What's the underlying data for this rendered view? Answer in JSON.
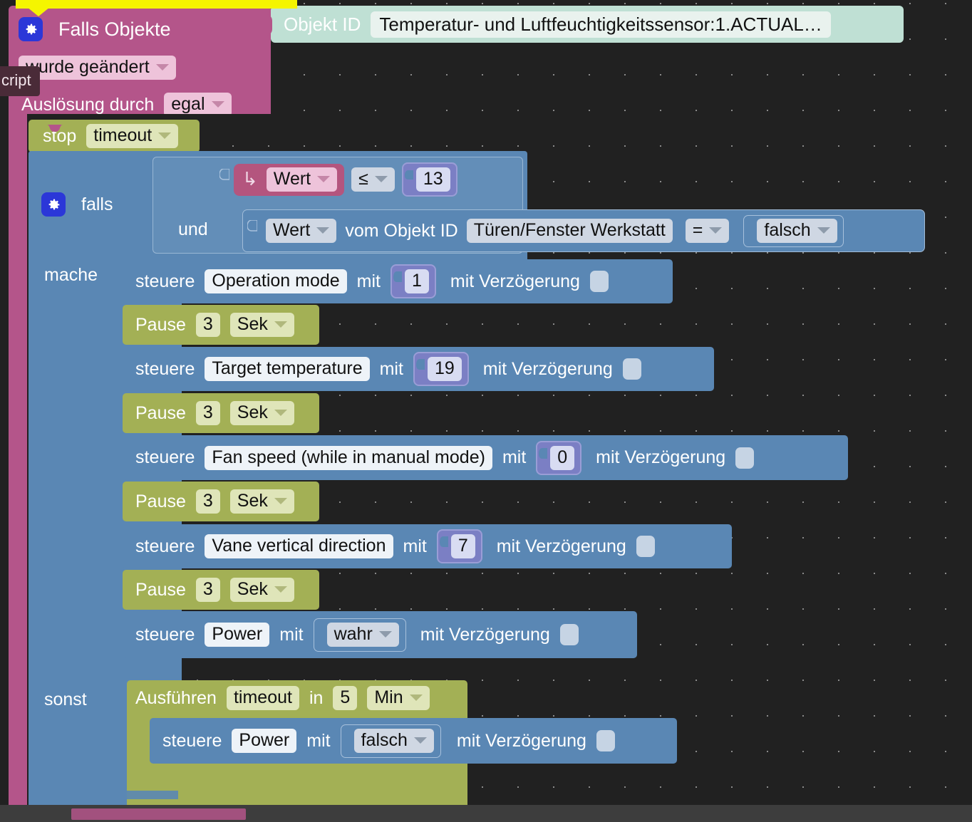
{
  "workspace": {
    "background_color": "#212121",
    "grid_dot_color": "#8a8a8a",
    "grid_spacing_px": 50
  },
  "tooltip": {
    "text": "cript"
  },
  "trigger_block": {
    "gear_icon": "gear-icon",
    "title": "Falls Objekte",
    "condition_dropdown": "wurde geändert",
    "source_label": "Auslösung durch",
    "source_dropdown": "egal",
    "object_id_label": "Objekt ID",
    "object_id_value": "Temperatur- und Luftfeuchtigkeitssensor:1.ACTUAL…",
    "color": "#b4558a",
    "object_id_color": "#bfe0d4"
  },
  "stop_block": {
    "label": "stop",
    "timer_dropdown": "timeout",
    "color": "#a3b055"
  },
  "if_block": {
    "gear_icon": "gear-icon",
    "if_label": "falls",
    "and_label": "und",
    "do_label": "mache",
    "else_label": "sonst",
    "color": "#5a87b4"
  },
  "condition_1": {
    "value_icon": "return-arrow-icon",
    "left_dropdown": "Wert",
    "operator": "≤",
    "right_number": "13",
    "left_color": "#b4557e",
    "number_color": "#7b7fc4"
  },
  "condition_2": {
    "left_dropdown": "Wert",
    "middle_label": "vom Objekt ID",
    "object_id": "Türen/Fenster Werkstatt",
    "operator": "=",
    "right_value": "falsch"
  },
  "do_statements": [
    {
      "type": "control",
      "verb": "steuere",
      "target": "Operation mode",
      "with_label": "mit",
      "value": "1",
      "value_kind": "number",
      "delay_label": "mit Verzögerung",
      "delay_checked": false
    },
    {
      "type": "pause",
      "verb": "Pause",
      "amount": "3",
      "unit": "Sek"
    },
    {
      "type": "control",
      "verb": "steuere",
      "target": "Target temperature",
      "with_label": "mit",
      "value": "19",
      "value_kind": "number",
      "delay_label": "mit Verzögerung",
      "delay_checked": false
    },
    {
      "type": "pause",
      "verb": "Pause",
      "amount": "3",
      "unit": "Sek"
    },
    {
      "type": "control",
      "verb": "steuere",
      "target": "Fan speed (while in manual mode)",
      "with_label": "mit",
      "value": "0",
      "value_kind": "number",
      "delay_label": "mit Verzögerung",
      "delay_checked": false
    },
    {
      "type": "pause",
      "verb": "Pause",
      "amount": "3",
      "unit": "Sek"
    },
    {
      "type": "control",
      "verb": "steuere",
      "target": "Vane vertical direction",
      "with_label": "mit",
      "value": "7",
      "value_kind": "number",
      "delay_label": "mit Verzögerung",
      "delay_checked": false
    },
    {
      "type": "pause",
      "verb": "Pause",
      "amount": "3",
      "unit": "Sek"
    },
    {
      "type": "control",
      "verb": "steuere",
      "target": "Power",
      "with_label": "mit",
      "value": "wahr",
      "value_kind": "boolean",
      "delay_label": "mit Verzögerung",
      "delay_checked": false
    }
  ],
  "else_statements": {
    "timeout_block": {
      "verb": "Ausführen",
      "timer_name": "timeout",
      "in_label": "in",
      "amount": "5",
      "unit": "Min",
      "color": "#a3b055"
    },
    "inner": {
      "verb": "steuere",
      "target": "Power",
      "with_label": "mit",
      "value": "falsch",
      "value_kind": "boolean",
      "delay_label": "mit Verzögerung",
      "delay_checked": false
    }
  }
}
